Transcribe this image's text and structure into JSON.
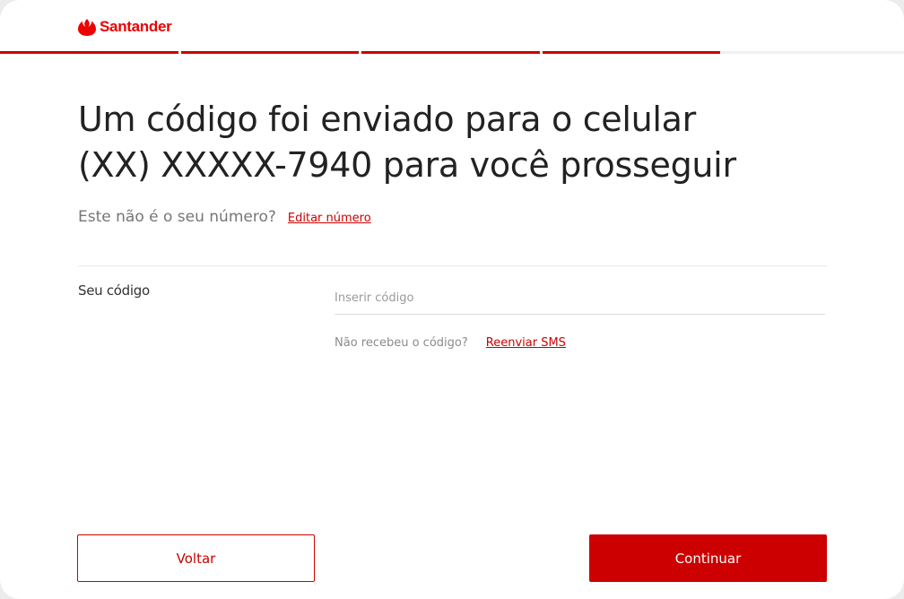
{
  "brand": {
    "name": "Santander",
    "logo_icon": "santander-flame-icon",
    "color": "#ec0000"
  },
  "progress": {
    "steps_total": 5,
    "steps_completed": 4,
    "active_color": "#cc0000",
    "inactive_color": "#f0f0f0"
  },
  "main": {
    "title_line1": "Um código foi enviado para o celular",
    "title_line2": "(XX) XXXXX-7940 para você prosseguir",
    "not_your_number": "Este não é o seu número?",
    "edit_number_link": "Editar número"
  },
  "code": {
    "label": "Seu código",
    "value": "",
    "placeholder": "Inserir código",
    "not_received": "Não recebeu o código?",
    "resend_link": "Reenviar SMS"
  },
  "buttons": {
    "back_label": "Voltar",
    "continue_label": "Continuar"
  }
}
